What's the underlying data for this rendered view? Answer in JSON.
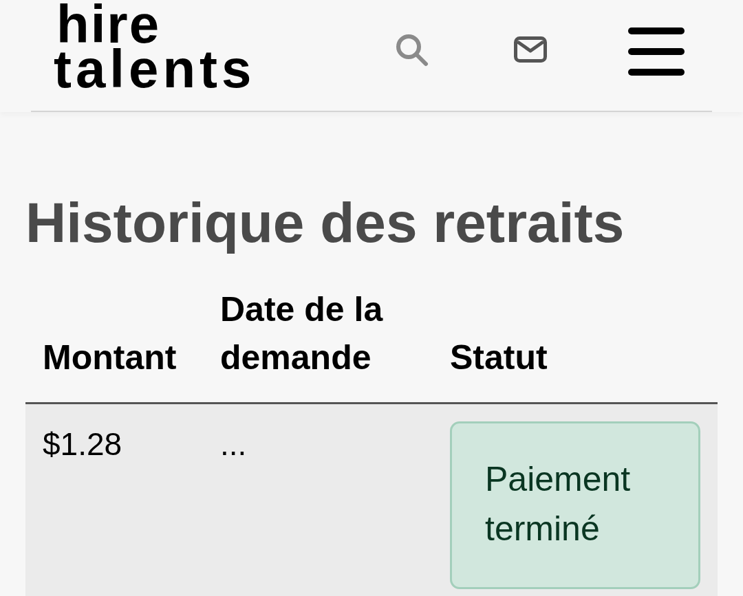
{
  "header": {
    "logo": [
      "hire",
      "talents"
    ]
  },
  "page_title": "Historique des retraits",
  "table": {
    "columns": [
      "Montant",
      "Date de la demande",
      "Statut"
    ],
    "rows": [
      {
        "amount": "$1.28",
        "date": "...",
        "status": "Paiement terminé"
      }
    ]
  }
}
